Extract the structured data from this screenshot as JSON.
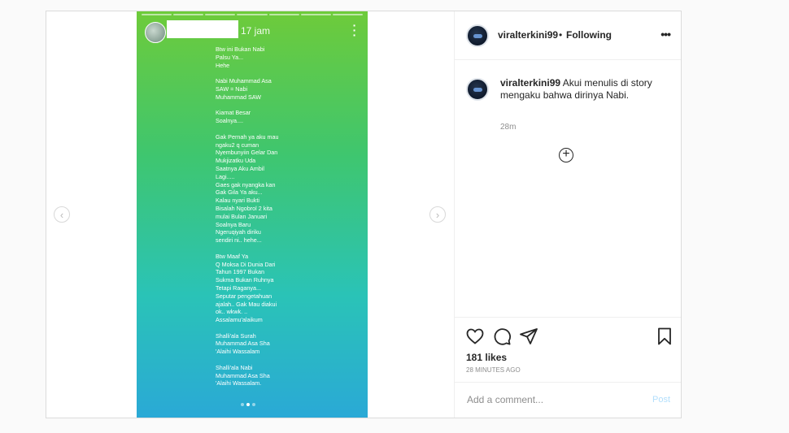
{
  "story": {
    "time": "17 jam",
    "text": "Btw ini Bukan Nabi\nPalsu Ya...\nHehe\n\nNabi Muhammad Asa\nSAW = Nabi\nMuhammad SAW\n\nKiamat Besar\nSoalnya....\n\nGak Pernah ya aku mau\nngaku2 q cuman\nNyembunyiin Gelar Dan\nMukjizatku Uda\nSaatnya Aku Ambil\nLagi.....\nGaes gak nyangka kan\nGak Gila Ya aku...\nKalau nyari Bukti\nBisalah Ngobrol 2 kita\nmulai Bulan Januari\nSoalnya Baru\nNgeruqiyah diriku\nsendiri ni.. hehe...\n\nBtw Maaf Ya\nQ Moksa Di Dunia Dari\nTahun 1997 Bukan\nSukma Bukan Ruhnya\nTetapi Raganya...\nSeputar pengetahuan\najalah.. Gak Mau diakui\nok.. wkwk. ..\nAssalamu'alaikum\n\nShalli'ala Surah\nMuhammad Asa Sha\n'Alaihi Wassalam\n\nShalli'ala Nabi\nMuhammad Asa Sha\n'Alaihi Wassalam."
  },
  "header": {
    "username": "viralterkini99",
    "separator": "•",
    "follow_label": "Following"
  },
  "caption": {
    "username": "viralterkini99",
    "text": " Akui menulis di story mengaku bahwa dirinya Nabi.",
    "time": "28m"
  },
  "actions": {
    "likes": "181 likes",
    "time_ago": "28 MINUTES AGO"
  },
  "comment": {
    "placeholder": "Add a comment...",
    "post_label": "Post"
  },
  "icons": {
    "heart": "heart-icon",
    "comment": "comment-icon",
    "share": "share-icon",
    "save": "bookmark-icon",
    "more": "more-icon",
    "plus": "plus-icon"
  },
  "colors": {
    "post_button": "#b2dffc",
    "secondary_text": "#8e8e8e",
    "border": "#dbdbdb"
  }
}
